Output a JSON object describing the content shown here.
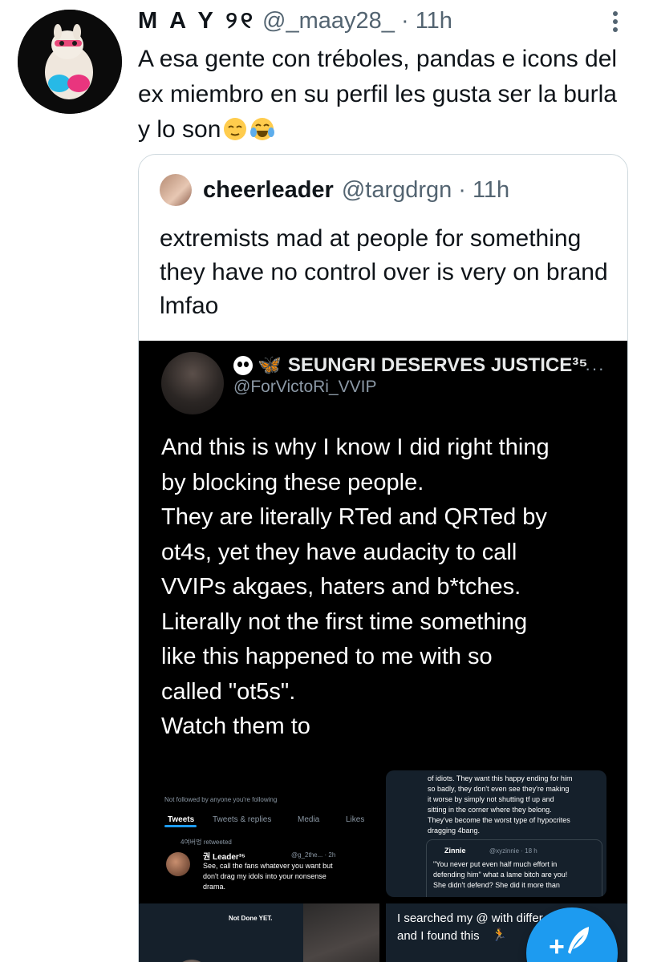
{
  "tweet": {
    "display_name": "M A Y ୨୧",
    "handle": "@_maay28_",
    "separator": "·",
    "time": "11h",
    "text": "A esa gente con tréboles, pandas e icons del ex miembro en su perfil les gusta ser la burla y lo son",
    "emojis": [
      "relieved-face",
      "face-with-tears-of-joy"
    ]
  },
  "quoted_tweet": {
    "display_name": "cheerleader",
    "handle": "@targdrgn",
    "separator": "·",
    "time": "11h",
    "text": "extremists mad at people for something they have no control over is very on brand lmfao"
  },
  "screenshot": {
    "display_name": "SEUNGRI DESERVES JUSTICE³⁵",
    "handle": "@ForVictoRi_VVIP",
    "more": "···",
    "text_lines": [
      "And this is why I know I did right thing",
      "by blocking these people.",
      "They are literally RTed and QRTed by",
      "ot4s, yet they have audacity to call",
      "VVIPs akgaes, haters and b*tches.",
      "Literally not the first time something",
      "like this happened to me with so",
      "called \"ot5s\".",
      "Watch them to"
    ],
    "panel_a": {
      "not_followed": "Not followed by anyone you're following",
      "tabs": [
        "Tweets",
        "Tweets & replies",
        "Media",
        "Likes"
      ],
      "retweeted": "4여버멍 retweeted",
      "author": "권 Leader³⁵",
      "author_meta": "@g_2the... · 2h",
      "lines": [
        "See, call the fans whatever you want but",
        "don't drag my idols into your nonsense",
        "drama."
      ]
    },
    "panel_b": {
      "lines": [
        "of idiots. They want this happy ending for him",
        "so badly, they don't even see they're making",
        "it worse by simply not shutting tf up and",
        "sitting in the corner where they belong.",
        "They've become the worst type of hypocrites",
        "dragging 4bang."
      ],
      "quote_author": "Zinnie",
      "quote_meta": "@xyzinnie · 18 h",
      "quote_lines": [
        "\"You never put even half much effort in",
        "defending him\" what a lame bitch are you!",
        "She didn't defend? She did it more than"
      ]
    },
    "panel_c": {
      "label": "Not Done YET."
    },
    "panel_d": {
      "lines": [
        "I searched my @ with differ",
        "and I found this"
      ]
    }
  },
  "fab": {
    "label": "+"
  }
}
